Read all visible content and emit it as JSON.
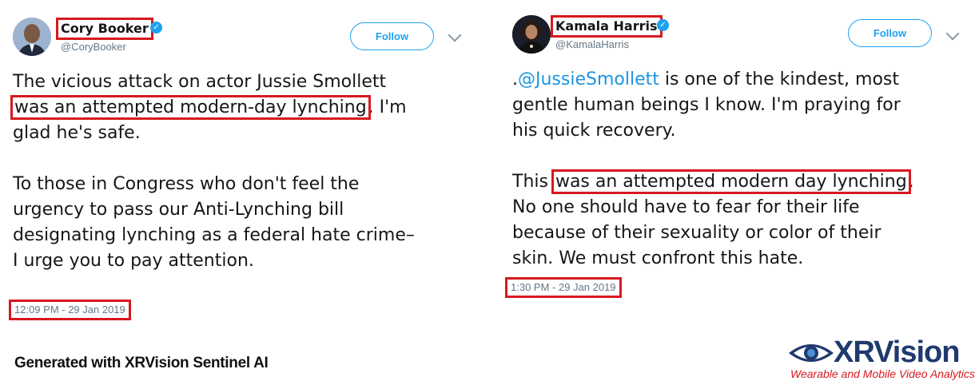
{
  "tweets": [
    {
      "name": "Cory Booker",
      "handle": "@CoryBooker",
      "follow_label": "Follow",
      "lines": [
        "The vicious attack on actor Jussie Smollett",
        "was an attempted modern-day lynching",
        ". I'm",
        "glad he's safe.",
        "To those in Congress who don't feel the",
        "urgency to pass our Anti-Lynching bill",
        "designating lynching as a federal hate crime–",
        "I urge you to pay attention."
      ],
      "timestamp": "12:09 PM - 29 Jan 2019"
    },
    {
      "name": "Kamala Harris",
      "handle": "@KamalaHarris",
      "follow_label": "Follow",
      "lines": [
        ".",
        "@JussieSmollett",
        " is one of the kindest, most",
        "gentle human beings I know. I'm praying for",
        "his quick recovery.",
        "This ",
        "was an attempted modern day lynching",
        ".",
        "No one should have to fear for their life",
        "because of their sexuality or color of their",
        "skin. We must confront this hate."
      ],
      "timestamp": "1:30 PM - 29 Jan 2019"
    }
  ],
  "credit": "Generated with XRVision Sentinel AI",
  "logo": {
    "name": "XRVision",
    "tagline": "Wearable and Mobile Video Analytics"
  },
  "colors": {
    "highlight": "#d8191f",
    "link": "#1b95e0",
    "follow": "#1da1f2"
  }
}
